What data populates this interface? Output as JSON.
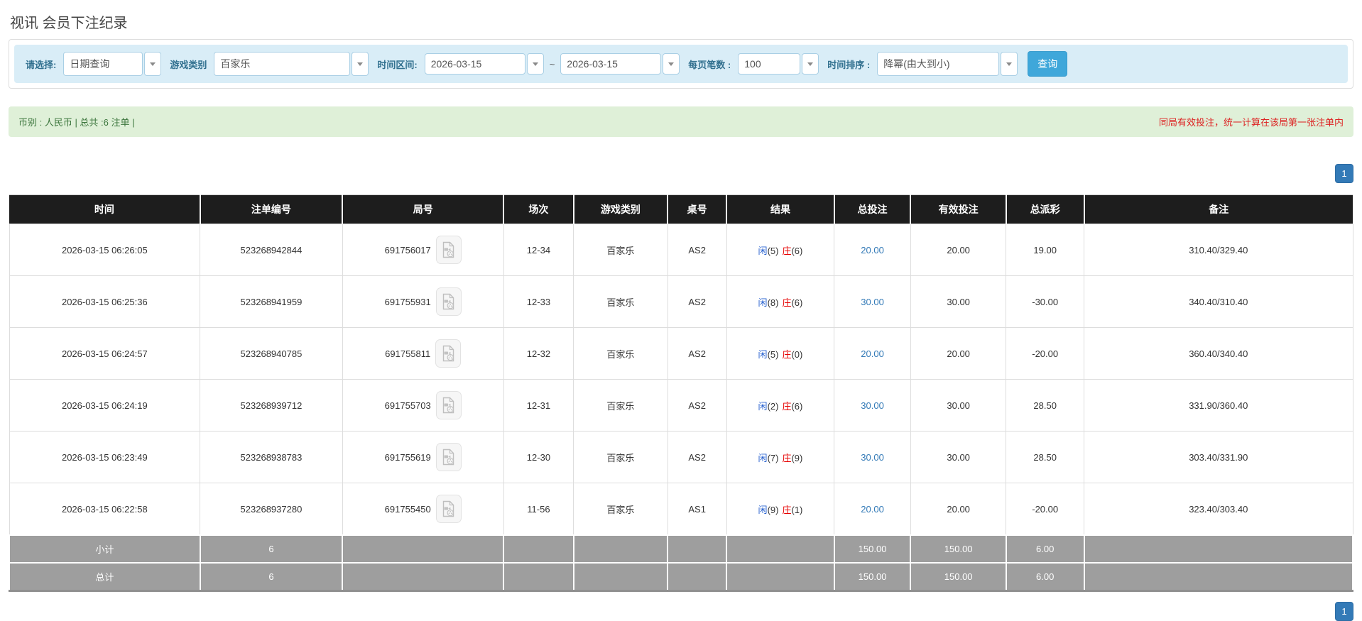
{
  "page": {
    "title": "视讯 会员下注纪录"
  },
  "filters": {
    "select_label": "请选择:",
    "select_value": "日期查询",
    "game_type_label": "游戏类别",
    "game_type_value": "百家乐",
    "time_range_label": "时间区间:",
    "date_from": "2026-03-15",
    "tilde": "~",
    "date_to": "2026-03-15",
    "page_size_label": "每页笔数 :",
    "page_size_value": "100",
    "sort_label": "时间排序 :",
    "sort_value": "降幂(由大到小)",
    "search_button": "查询"
  },
  "summary": {
    "left": "币别 : 人民币 | 总共 :6 注单 |",
    "right": "同局有效投注，统一计算在该局第一张注单内"
  },
  "pagination": {
    "page": "1"
  },
  "icons": {
    "dropdown_arrow": "chevron-down",
    "round_video": "video-file"
  },
  "colors": {
    "filter_bar_bg": "#d9edf7",
    "filter_label": "#31708f",
    "search_button": "#3fa7da",
    "summary_bg": "#dff0d8",
    "summary_text": "#3c763d",
    "notice_red": "#dd2222",
    "table_header_bg": "#1d1d1d",
    "footer_bg": "#9e9e9e",
    "link_blue": "#337ab7",
    "player_blue": "#2a63d0",
    "banker_red": "#e60000",
    "negative_red": "#e60000",
    "pagination_blue": "#337ab7"
  },
  "table": {
    "headers": [
      "时间",
      "注单编号",
      "局号",
      "场次",
      "游戏类别",
      "桌号",
      "结果",
      "总投注",
      "有效投注",
      "总派彩",
      "备注"
    ],
    "rows": [
      {
        "time": "2026-03-15 06:26:05",
        "bet_id": "523268942844",
        "round_id": "691756017",
        "session": "12-34",
        "game": "百家乐",
        "table_no": "AS2",
        "player_label": "闲",
        "player_value": "(5)",
        "banker_label": "庄",
        "banker_value": "(6)",
        "total_bet": "20.00",
        "valid_bet": "20.00",
        "payout": "19.00",
        "note": "310.40/329.40"
      },
      {
        "time": "2026-03-15 06:25:36",
        "bet_id": "523268941959",
        "round_id": "691755931",
        "session": "12-33",
        "game": "百家乐",
        "table_no": "AS2",
        "player_label": "闲",
        "player_value": "(8)",
        "banker_label": "庄",
        "banker_value": "(6)",
        "total_bet": "30.00",
        "valid_bet": "30.00",
        "payout": "-30.00",
        "note": "340.40/310.40"
      },
      {
        "time": "2026-03-15 06:24:57",
        "bet_id": "523268940785",
        "round_id": "691755811",
        "session": "12-32",
        "game": "百家乐",
        "table_no": "AS2",
        "player_label": "闲",
        "player_value": "(5)",
        "banker_label": "庄",
        "banker_value": "(0)",
        "total_bet": "20.00",
        "valid_bet": "20.00",
        "payout": "-20.00",
        "note": "360.40/340.40"
      },
      {
        "time": "2026-03-15 06:24:19",
        "bet_id": "523268939712",
        "round_id": "691755703",
        "session": "12-31",
        "game": "百家乐",
        "table_no": "AS2",
        "player_label": "闲",
        "player_value": "(2)",
        "banker_label": "庄",
        "banker_value": "(6)",
        "total_bet": "30.00",
        "valid_bet": "30.00",
        "payout": "28.50",
        "note": "331.90/360.40"
      },
      {
        "time": "2026-03-15 06:23:49",
        "bet_id": "523268938783",
        "round_id": "691755619",
        "session": "12-30",
        "game": "百家乐",
        "table_no": "AS2",
        "player_label": "闲",
        "player_value": "(7)",
        "banker_label": "庄",
        "banker_value": "(9)",
        "total_bet": "30.00",
        "valid_bet": "30.00",
        "payout": "28.50",
        "note": "303.40/331.90"
      },
      {
        "time": "2026-03-15 06:22:58",
        "bet_id": "523268937280",
        "round_id": "691755450",
        "session": "11-56",
        "game": "百家乐",
        "table_no": "AS1",
        "player_label": "闲",
        "player_value": "(9)",
        "banker_label": "庄",
        "banker_value": "(1)",
        "total_bet": "20.00",
        "valid_bet": "20.00",
        "payout": "-20.00",
        "note": "323.40/303.40"
      }
    ],
    "footer": [
      {
        "label": "小计",
        "count": "6",
        "total_bet": "150.00",
        "valid_bet": "150.00",
        "payout": "6.00"
      },
      {
        "label": "总计",
        "count": "6",
        "total_bet": "150.00",
        "valid_bet": "150.00",
        "payout": "6.00"
      }
    ]
  }
}
